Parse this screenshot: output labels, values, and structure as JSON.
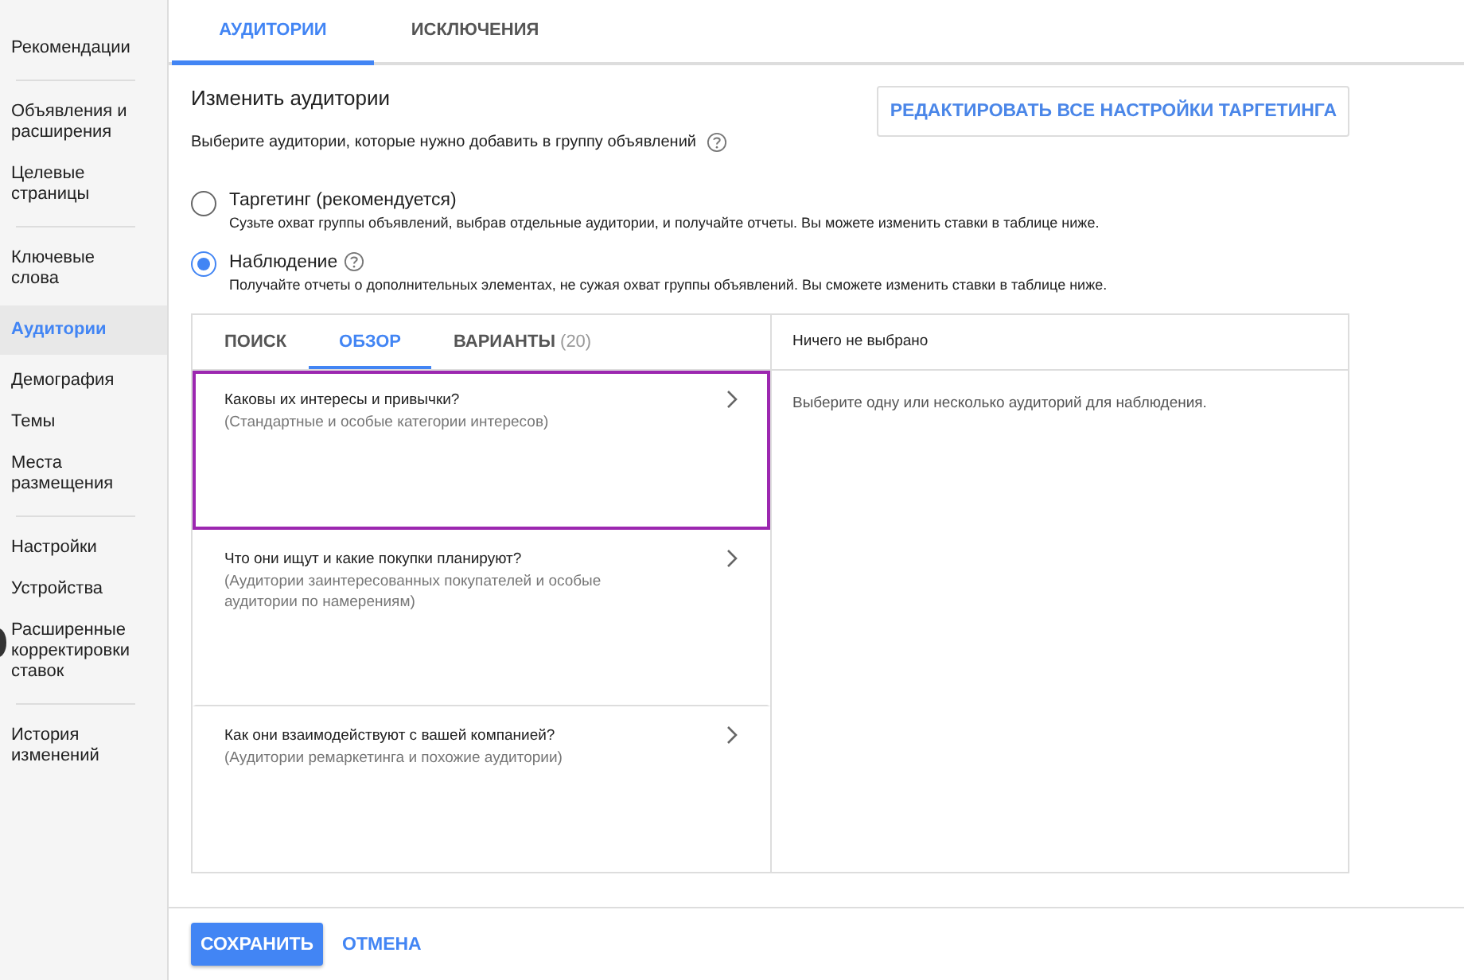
{
  "sidebar": {
    "groups": [
      [
        {
          "label": "Рекомендации",
          "selected": false
        }
      ],
      [
        {
          "label": "Объявления и расширения",
          "selected": false
        },
        {
          "label": "Целевые страницы",
          "selected": false
        }
      ],
      [
        {
          "label": "Ключевые слова",
          "selected": false
        },
        {
          "label": "Аудитории",
          "selected": true
        },
        {
          "label": "Демография",
          "selected": false
        },
        {
          "label": "Темы",
          "selected": false
        },
        {
          "label": "Места размещения",
          "selected": false
        }
      ],
      [
        {
          "label": "Настройки",
          "selected": false
        },
        {
          "label": "Устройства",
          "selected": false
        },
        {
          "label": "Расширенные корректировки ставок",
          "selected": false
        }
      ],
      [
        {
          "label": "История изменений",
          "selected": false
        }
      ]
    ]
  },
  "tabs": [
    {
      "label": "АУДИТОРИИ",
      "selected": true
    },
    {
      "label": "ИСКЛЮЧЕНИЯ",
      "selected": false
    }
  ],
  "heading": "Изменить аудитории",
  "description": "Выберите аудитории, которые нужно добавить в группу объявлений",
  "edit_button": "РЕДАКТИРОВАТЬ ВСЕ НАСТРОЙКИ ТАРГЕТИНГА",
  "options": [
    {
      "label": "Таргетинг (рекомендуется)",
      "help": false,
      "selected": false,
      "description": "Сузьте охват группы объявлений, выбрав отдельные аудитории, и получайте отчеты. Вы можете изменить ставки в таблице ниже."
    },
    {
      "label": "Наблюдение",
      "help": true,
      "selected": true,
      "description": "Получайте отчеты о дополнительных элементах, не сужая охват группы объявлений. Вы сможете изменить ставки в таблице ниже."
    }
  ],
  "panel": {
    "tabs": [
      {
        "label": "ПОИСК",
        "selected": false
      },
      {
        "label": "ОБЗОР",
        "selected": true
      },
      {
        "label": "ВАРИАНТЫ",
        "count": "(20)",
        "selected": false
      }
    ],
    "rows": [
      {
        "title": "Каковы их интересы и привычки?",
        "subtitle": "(Стандартные и особые категории интересов)",
        "highlighted": true
      },
      {
        "title": "Что они ищут и какие покупки планируют?",
        "subtitle": "(Аудитории заинтересованных покупателей и особые аудитории по намерениям)",
        "highlighted": false
      },
      {
        "title": "Как они взаимодействуют с вашей компанией?",
        "subtitle": "(Аудитории ремаркетинга и похожие аудитории)",
        "highlighted": false
      }
    ],
    "selection_header": "Ничего не выбрано",
    "selection_hint": "Выберите одну или несколько аудиторий для наблюдения."
  },
  "actions": {
    "save": "СОХРАНИТЬ",
    "cancel": "ОТМЕНА"
  }
}
